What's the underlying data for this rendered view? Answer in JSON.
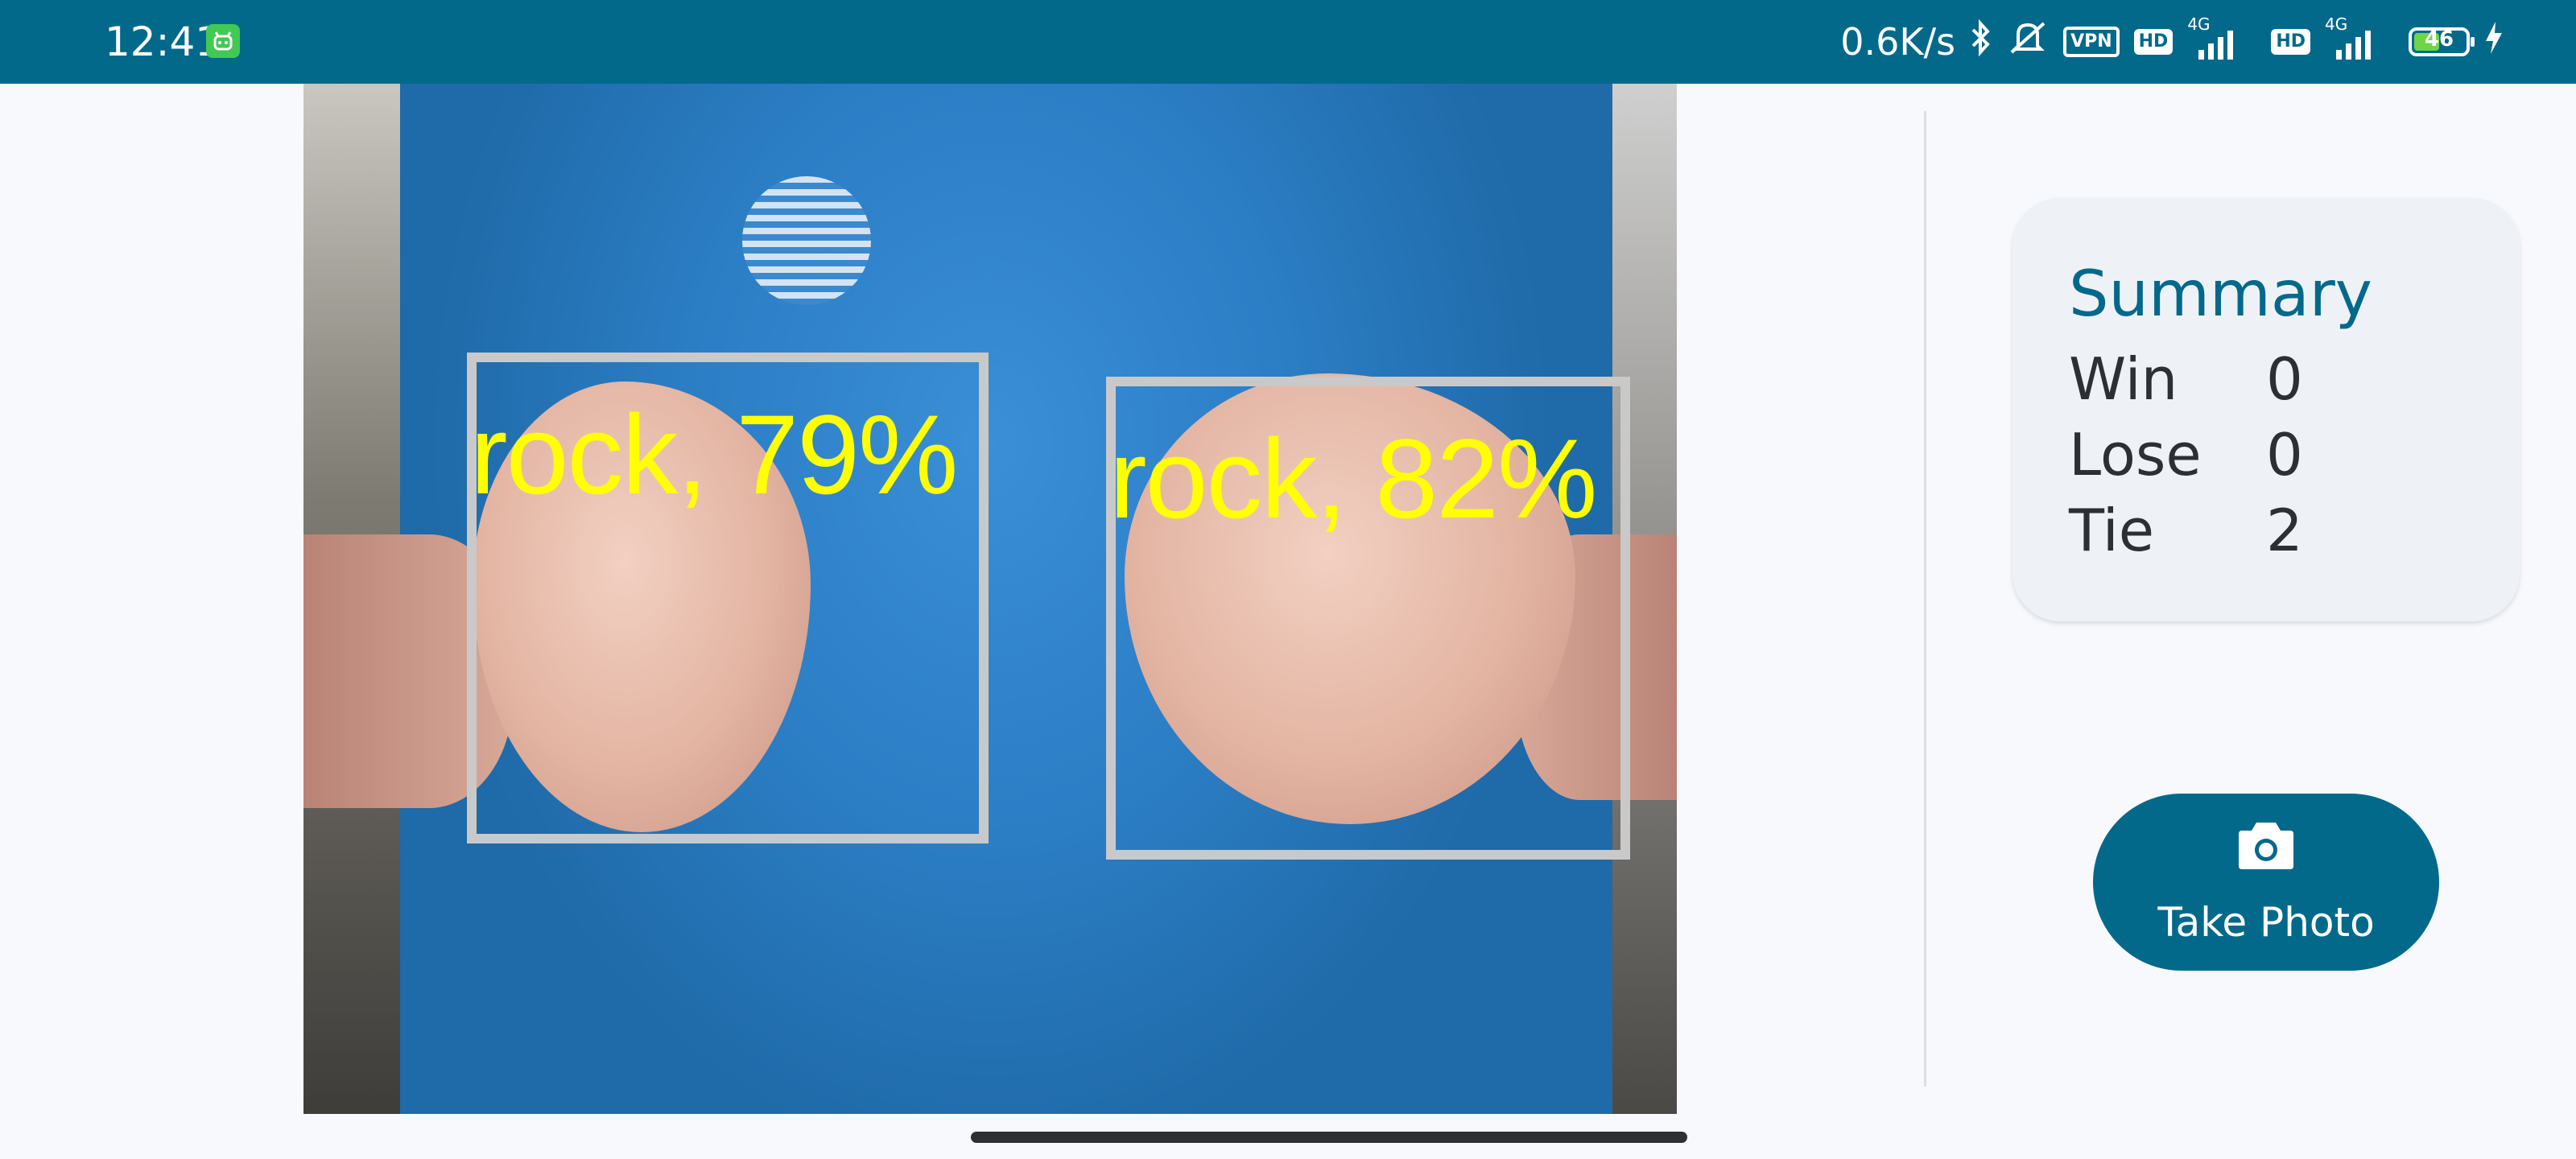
{
  "status_bar": {
    "time": "12:41",
    "net_speed": "0.6K/s",
    "vpn_label": "VPN",
    "hd_label": "HD",
    "network_type": "4G",
    "battery_level": "46",
    "icons": [
      "app-notification-icon",
      "bluetooth-icon",
      "mute-icon",
      "vpn-icon",
      "hd-icon",
      "signal-icon",
      "battery-icon",
      "charging-icon"
    ]
  },
  "camera_view": {
    "detections": [
      {
        "label": "rock, 79%"
      },
      {
        "label": "rock, 82%"
      }
    ],
    "box_color": "#c9c9c9",
    "label_color": "#ffff00"
  },
  "summary": {
    "title": "Summary",
    "rows": [
      {
        "label": "Win",
        "value": "0"
      },
      {
        "label": "Lose",
        "value": "0"
      },
      {
        "label": "Tie",
        "value": "2"
      }
    ]
  },
  "take_photo": {
    "label": "Take Photo",
    "icon": "camera-icon"
  },
  "colors": {
    "accent": "#03698b",
    "background": "#f8f9fd",
    "card": "#eef2f7"
  }
}
